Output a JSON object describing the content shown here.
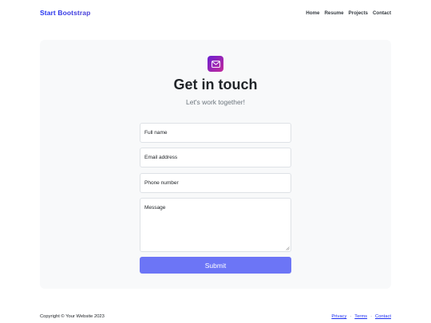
{
  "navbar": {
    "brand": "Start Bootstrap",
    "links": [
      "Home",
      "Resume",
      "Projects",
      "Contact"
    ]
  },
  "contact": {
    "icon": "envelope-icon",
    "title": "Get in touch",
    "subtitle": "Let's work together!",
    "fields": {
      "full_name": "Full name",
      "email": "Email address",
      "phone": "Phone number",
      "message": "Message"
    },
    "submit_label": "Submit"
  },
  "footer": {
    "copyright": "Copyright © Your Website 2023",
    "links": [
      "Privacy",
      "Terms",
      "Contact"
    ],
    "separator": "·"
  },
  "colors": {
    "brand": "#1e30f3",
    "submit_button": "#6c75f6",
    "card_bg": "#f8f9fa",
    "icon_gradient_start": "#6a1fd1",
    "icon_gradient_end": "#c42a9a"
  }
}
